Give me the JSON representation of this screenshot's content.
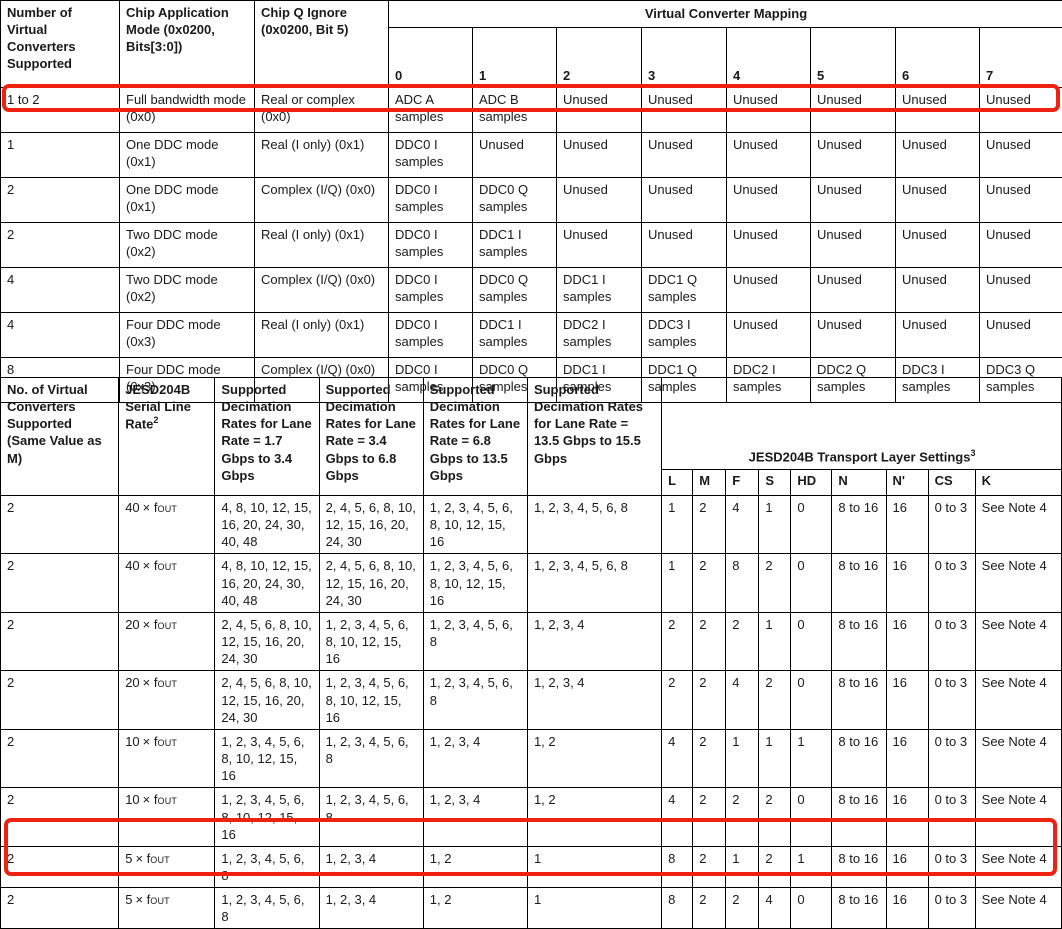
{
  "table1": {
    "headers": {
      "col0": "Number of Virtual Converters Supported",
      "col1": "Chip Application Mode (0x0200, Bits[3:0])",
      "col2": "Chip Q Ignore (0x0200, Bit 5)",
      "group_title": "Virtual Converter Mapping",
      "indices": [
        "0",
        "1",
        "2",
        "3",
        "4",
        "5",
        "6",
        "7"
      ]
    },
    "rows": [
      {
        "converters": "1 to 2",
        "mode": "Full bandwidth mode (0x0)",
        "q_ignore": "Real or complex (0x0)",
        "mapping": [
          "ADC A samples",
          "ADC B samples",
          "Unused",
          "Unused",
          "Unused",
          "Unused",
          "Unused",
          "Unused"
        ],
        "highlighted": true
      },
      {
        "converters": "1",
        "mode": "One DDC mode (0x1)",
        "q_ignore": "Real (I only) (0x1)",
        "mapping": [
          "DDC0 I samples",
          "Unused",
          "Unused",
          "Unused",
          "Unused",
          "Unused",
          "Unused",
          "Unused"
        ],
        "highlighted": false
      },
      {
        "converters": "2",
        "mode": "One DDC mode (0x1)",
        "q_ignore": "Complex (I/Q) (0x0)",
        "mapping": [
          "DDC0 I samples",
          "DDC0 Q samples",
          "Unused",
          "Unused",
          "Unused",
          "Unused",
          "Unused",
          "Unused"
        ],
        "highlighted": false
      },
      {
        "converters": "2",
        "mode": "Two DDC mode (0x2)",
        "q_ignore": "Real (I only) (0x1)",
        "mapping": [
          "DDC0 I samples",
          "DDC1 I samples",
          "Unused",
          "Unused",
          "Unused",
          "Unused",
          "Unused",
          "Unused"
        ],
        "highlighted": false
      },
      {
        "converters": "4",
        "mode": "Two DDC mode (0x2)",
        "q_ignore": "Complex (I/Q) (0x0)",
        "mapping": [
          "DDC0 I samples",
          "DDC0 Q samples",
          "DDC1 I samples",
          "DDC1 Q samples",
          "Unused",
          "Unused",
          "Unused",
          "Unused"
        ],
        "highlighted": false
      },
      {
        "converters": "4",
        "mode": "Four DDC mode (0x3)",
        "q_ignore": "Real (I only) (0x1)",
        "mapping": [
          "DDC0 I samples",
          "DDC1 I samples",
          "DDC2 I samples",
          "DDC3 I samples",
          "Unused",
          "Unused",
          "Unused",
          "Unused"
        ],
        "highlighted": false
      },
      {
        "converters": "8",
        "mode": "Four DDC mode (0x3)",
        "q_ignore": "Complex (I/Q) (0x0)",
        "mapping": [
          "DDC0 I samples",
          "DDC0 Q samples",
          "DDC1 I samples",
          "DDC1 Q samples",
          "DDC2 I samples",
          "DDC2 Q samples",
          "DDC3 I samples",
          "DDC3 Q samples"
        ],
        "highlighted": false
      }
    ]
  },
  "table2": {
    "headers": {
      "col0": "No. of Virtual Converters Supported (Same Value as M)",
      "col1_pre": "JESD204B Serial Line Rate",
      "col1_sup": "2",
      "col2": "Supported Decimation Rates for Lane Rate = 1.7 Gbps to 3.4 Gbps",
      "col3": "Supported Decimation Rates for Lane Rate = 3.4 Gbps to 6.8 Gbps",
      "col4": "Supported Decimation Rates for Lane Rate = 6.8 Gbps to 13.5 Gbps",
      "col5": "Supported Decimation Rates for Lane Rate = 13.5 Gbps to 15.5 Gbps",
      "group_title_pre": "JESD204B Transport Layer Settings",
      "group_title_sup": "3",
      "settings": [
        "L",
        "M",
        "F",
        "S",
        "HD",
        "N",
        "N'",
        "CS",
        "K"
      ]
    },
    "rows": [
      {
        "converters": "2",
        "line_rate_mult": "40",
        "line_rate_sym": "× f",
        "line_rate_sub": "OUT",
        "dec_17_34": "4, 8, 10, 12, 15, 16, 20, 24, 30, 40, 48",
        "dec_34_68": "2, 4, 5, 6, 8, 10, 12, 15, 16, 20, 24, 30",
        "dec_68_135": "1, 2, 3, 4, 5, 6, 8, 10, 12, 15, 16",
        "dec_135_155": "1, 2, 3, 4, 5, 6, 8",
        "settings": [
          "1",
          "2",
          "4",
          "1",
          "0",
          "8 to 16",
          "16",
          "0 to 3",
          "See Note 4"
        ],
        "highlighted": false
      },
      {
        "converters": "2",
        "line_rate_mult": "40",
        "line_rate_sym": "× f",
        "line_rate_sub": "OUT",
        "dec_17_34": "4, 8, 10, 12, 15, 16, 20, 24, 30, 40, 48",
        "dec_34_68": "2, 4, 5, 6, 8, 10, 12, 15, 16, 20, 24, 30",
        "dec_68_135": "1, 2, 3, 4, 5, 6, 8, 10, 12, 15, 16",
        "dec_135_155": "1, 2, 3, 4, 5, 6, 8",
        "settings": [
          "1",
          "2",
          "8",
          "2",
          "0",
          "8 to 16",
          "16",
          "0 to 3",
          "See Note 4"
        ],
        "highlighted": false
      },
      {
        "converters": "2",
        "line_rate_mult": "20",
        "line_rate_sym": "× f",
        "line_rate_sub": "OUT",
        "dec_17_34": "2, 4, 5, 6, 8, 10, 12, 15, 16, 20, 24, 30",
        "dec_34_68": "1, 2, 3, 4, 5, 6, 8, 10, 12, 15, 16",
        "dec_68_135": "1, 2, 3, 4, 5, 6, 8",
        "dec_135_155": "1, 2, 3, 4",
        "settings": [
          "2",
          "2",
          "2",
          "1",
          "0",
          "8 to 16",
          "16",
          "0 to 3",
          "See Note 4"
        ],
        "highlighted": false
      },
      {
        "converters": "2",
        "line_rate_mult": "20",
        "line_rate_sym": "× f",
        "line_rate_sub": "OUT",
        "dec_17_34": "2, 4, 5, 6, 8, 10, 12, 15, 16, 20, 24, 30",
        "dec_34_68": "1, 2, 3, 4, 5, 6, 8, 10, 12, 15, 16",
        "dec_68_135": "1, 2, 3, 4, 5, 6, 8",
        "dec_135_155": "1, 2, 3, 4",
        "settings": [
          "2",
          "2",
          "4",
          "2",
          "0",
          "8 to 16",
          "16",
          "0 to 3",
          "See Note 4"
        ],
        "highlighted": false
      },
      {
        "converters": "2",
        "line_rate_mult": "10",
        "line_rate_sym": "× f",
        "line_rate_sub": "OUT",
        "dec_17_34": "1, 2, 3, 4, 5, 6, 8, 10, 12, 15, 16",
        "dec_34_68": "1, 2, 3, 4, 5, 6, 8",
        "dec_68_135": "1, 2, 3, 4",
        "dec_135_155": "1, 2",
        "settings": [
          "4",
          "2",
          "1",
          "1",
          "1",
          "8 to 16",
          "16",
          "0 to 3",
          "See Note 4"
        ],
        "highlighted": false
      },
      {
        "converters": "2",
        "line_rate_mult": "10",
        "line_rate_sym": "× f",
        "line_rate_sub": "OUT",
        "dec_17_34": "1, 2, 3, 4, 5, 6, 8, 10, 12, 15, 16",
        "dec_34_68": "1, 2, 3, 4, 5, 6, 8",
        "dec_68_135": "1, 2, 3, 4",
        "dec_135_155": "1, 2",
        "settings": [
          "4",
          "2",
          "2",
          "2",
          "0",
          "8 to 16",
          "16",
          "0 to 3",
          "See Note 4"
        ],
        "highlighted": false
      },
      {
        "converters": "2",
        "line_rate_mult": "5",
        "line_rate_sym": "× f",
        "line_rate_sub": "OUT",
        "dec_17_34": "1, 2, 3, 4, 5, 6, 8",
        "dec_34_68": "1, 2, 3, 4",
        "dec_68_135": "1, 2",
        "dec_135_155": "1",
        "settings": [
          "8",
          "2",
          "1",
          "2",
          "1",
          "8 to 16",
          "16",
          "0 to 3",
          "See Note 4"
        ],
        "highlighted": false
      },
      {
        "converters": "2",
        "line_rate_mult": "5",
        "line_rate_sym": "× f",
        "line_rate_sub": "OUT",
        "dec_17_34": "1, 2, 3, 4, 5, 6, 8",
        "dec_34_68": "1, 2, 3, 4",
        "dec_68_135": "1, 2",
        "dec_135_155": "1",
        "settings": [
          "8",
          "2",
          "2",
          "4",
          "0",
          "8 to 16",
          "16",
          "0 to 3",
          "See Note 4"
        ],
        "highlighted": true
      }
    ]
  },
  "annotations": {
    "highlight_color": "#ee2211",
    "boxes": [
      {
        "name": "highlight-box-table1-row1"
      },
      {
        "name": "highlight-box-table2-last-row"
      }
    ]
  }
}
